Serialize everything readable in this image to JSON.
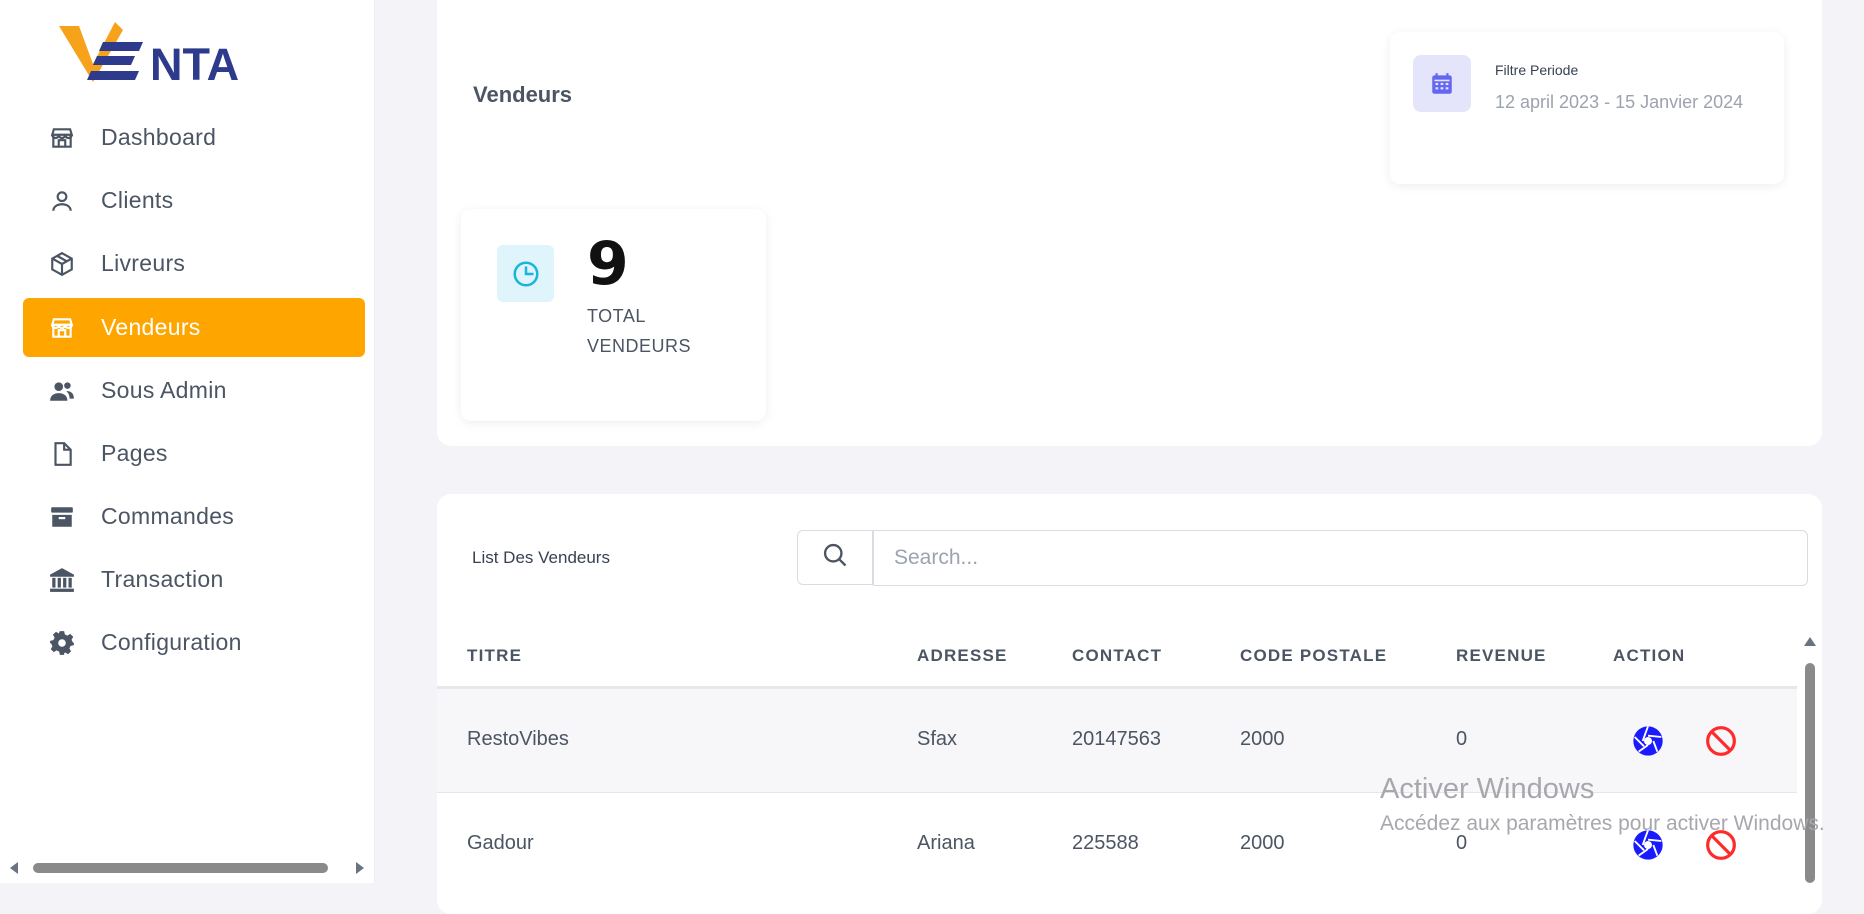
{
  "app": {
    "logo_text": "VENTA"
  },
  "sidebar": {
    "items": [
      {
        "label": "Dashboard",
        "icon": "store-icon"
      },
      {
        "label": "Clients",
        "icon": "user-icon"
      },
      {
        "label": "Livreurs",
        "icon": "box-icon"
      },
      {
        "label": "Vendeurs",
        "icon": "store-icon",
        "active": true
      },
      {
        "label": "Sous Admin",
        "icon": "users-icon"
      },
      {
        "label": "Pages",
        "icon": "file-icon"
      },
      {
        "label": "Commandes",
        "icon": "archive-icon"
      },
      {
        "label": "Transaction",
        "icon": "bank-icon"
      },
      {
        "label": "Configuration",
        "icon": "gear-icon"
      }
    ]
  },
  "header": {
    "title": "Vendeurs"
  },
  "filter": {
    "label": "Filtre Periode",
    "value": "12 april 2023 - 15 Janvier 2024"
  },
  "stat": {
    "value": "9",
    "label": "TOTAL VENDEURS"
  },
  "list": {
    "title": "List Des Vendeurs",
    "search_placeholder": "Search...",
    "columns": [
      "TITRE",
      "ADRESSE",
      "CONTACT",
      "CODE POSTALE",
      "REVENUE",
      "ACTION"
    ],
    "rows": [
      {
        "titre": "RestoVibes",
        "adresse": "Sfax",
        "contact": "20147563",
        "code_postale": "2000",
        "revenue": "0"
      },
      {
        "titre": "Gadour",
        "adresse": "Ariana",
        "contact": "225588",
        "code_postale": "2000",
        "revenue": "0"
      }
    ]
  },
  "watermark": {
    "line1": "Activer Windows",
    "line2": "Accédez aux paramètres pour activer Windows."
  },
  "colors": {
    "accent": "#ffa500",
    "logo_orange": "#f7a21b",
    "logo_navy": "#2e3a8c",
    "action_blue": "#1a1aff",
    "action_red": "#ff2a2a"
  }
}
